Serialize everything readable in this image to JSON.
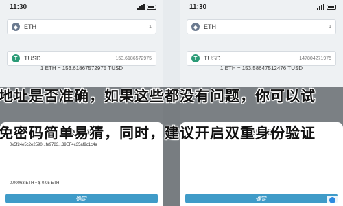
{
  "status": {
    "time": "11:30"
  },
  "tokens": [
    {
      "symbol": "ETH",
      "icon": "ethereum-icon",
      "amount_left": "1",
      "amount_right": "1",
      "balance": ""
    },
    {
      "symbol": "TUSD",
      "icon": "tusd-icon",
      "amount_left": "153.6186572975",
      "amount_right": "147804271975"
    }
  ],
  "rate": {
    "left": "1 ETH = 153.61867572975 TUSD",
    "right": "1 ETH = 153.58647512476 TUSD"
  },
  "sheet": {
    "title": "交易详情",
    "address_label": "",
    "address_left": "0x5f24e5c2e2590...fe9783...39EF4c35af9c1c4a",
    "fee_label": "",
    "fee_left": "0.00063 ETH ≈ $ 0.05 ETH",
    "confirm_label": "确定"
  },
  "captions": {
    "line1": "地址是否准确，如果这些都没有问题，你可以试",
    "line2": "免密码简单易猜，同时，建议开启双重身份验证"
  },
  "logo": {
    "text": ""
  },
  "colors": {
    "accent": "#3f9bc8",
    "tusd": "#2b9b77",
    "overlay": "#1e2328"
  }
}
